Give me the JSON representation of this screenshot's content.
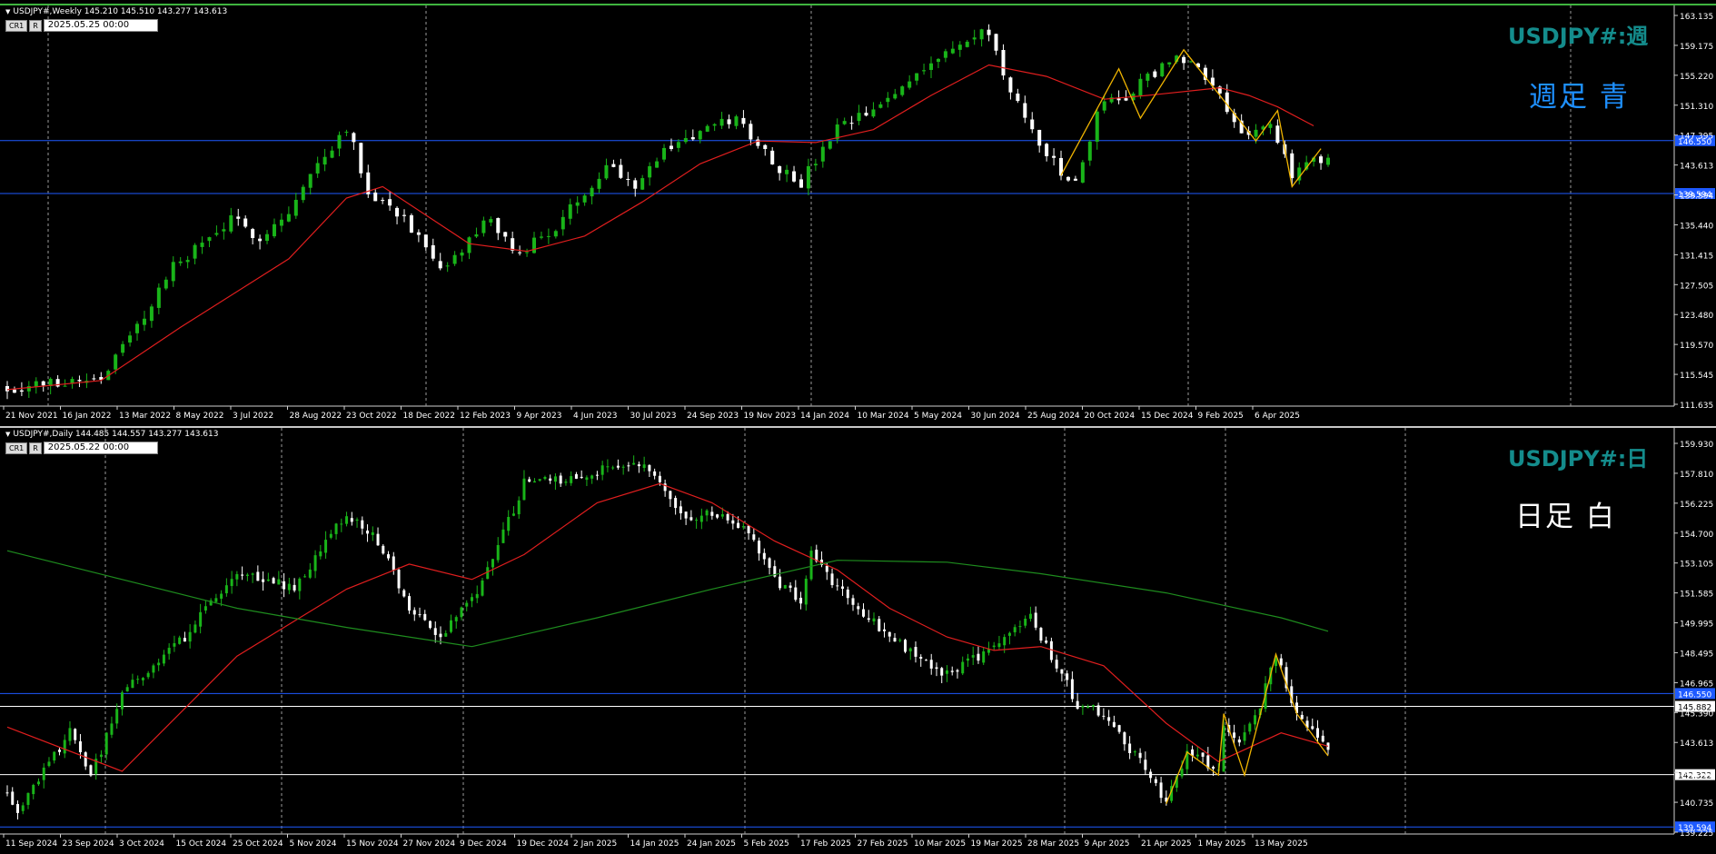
{
  "colors": {
    "background": "#000000",
    "bull_candle": "#19b419",
    "bear_candle": "#ffffff",
    "ma_red": "#e01e1e",
    "ma_green": "#1e8c1e",
    "zigzag": "#f0b400",
    "blue_level": "#1e5aff",
    "symbol_text": "#148c8c"
  },
  "weekly": {
    "header": "USDJPY#,Weekly  145.210 145.510 143.277 143.613",
    "box1": "CR1",
    "box2": "R",
    "date_box": "2025.05.25 00:00",
    "symbol_label": "USDJPY#:週",
    "note": "週足  青",
    "price_ticks": [
      "163.135",
      "159.175",
      "155.220",
      "151.310",
      "147.395",
      "143.613",
      "139.594",
      "135.440",
      "131.415",
      "127.505",
      "123.480",
      "119.570",
      "115.545",
      "111.635"
    ],
    "date_ticks": [
      "21 Nov 2021",
      "16 Jan 2022",
      "13 Mar 2022",
      "8 May 2022",
      "3 Jul 2022",
      "28 Aug 2022",
      "23 Oct 2022",
      "18 Dec 2022",
      "12 Feb 2023",
      "9 Apr 2023",
      "4 Jun 2023",
      "30 Jul 2023",
      "24 Sep 2023",
      "19 Nov 2023",
      "14 Jan 2024",
      "10 Mar 2024",
      "5 May 2024",
      "30 Jun 2024",
      "25 Aug 2024",
      "20 Oct 2024",
      "15 Dec 2024",
      "9 Feb 2025",
      "6 Apr 2025"
    ],
    "level_lines": [
      {
        "price": 146.55,
        "label": "146.550"
      },
      {
        "price": 139.594,
        "label": "139.594"
      }
    ],
    "current_price": "143.613"
  },
  "daily": {
    "header": "USDJPY#,Daily  144.485 144.557 143.277 143.613",
    "box1": "CR1",
    "box2": "R",
    "date_box": "2025.05.22 00:00",
    "symbol_label": "USDJPY#:日",
    "note": "日足   白",
    "price_ticks": [
      "159.930",
      "157.810",
      "156.225",
      "154.700",
      "153.105",
      "151.585",
      "149.995",
      "148.495",
      "146.965",
      "145.390",
      "143.613",
      "142.322",
      "140.735",
      "139.225"
    ],
    "date_ticks": [
      "11 Sep 2024",
      "23 Sep 2024",
      "3 Oct 2024",
      "15 Oct 2024",
      "25 Oct 2024",
      "5 Nov 2024",
      "15 Nov 2024",
      "27 Nov 2024",
      "9 Dec 2024",
      "19 Dec 2024",
      "2 Jan 2025",
      "14 Jan 2025",
      "24 Jan 2025",
      "5 Feb 2025",
      "17 Feb 2025",
      "27 Feb 2025",
      "10 Mar 2025",
      "19 Mar 2025",
      "28 Mar 2025",
      "9 Apr 2025",
      "21 Apr 2025",
      "1 May 2025",
      "13 May 2025"
    ],
    "level_lines": [
      {
        "price": 146.55,
        "label": "146.550",
        "color": "blue"
      },
      {
        "price": 145.882,
        "label": "145.882",
        "color": "white"
      },
      {
        "price": 142.322,
        "label": "142.322",
        "color": "white"
      },
      {
        "price": 139.594,
        "label": "139.594",
        "color": "blue"
      }
    ],
    "current_price": "143.613"
  },
  "chart_data": [
    {
      "type": "candlestick",
      "title": "USDJPY#,Weekly",
      "ylim": [
        111.635,
        163.135
      ],
      "x_range": [
        "21 Nov 2021",
        "25 May 2025"
      ],
      "path_points": [
        [
          "21 Nov 2021",
          114.0
        ],
        [
          "20 Feb 2022",
          115.5
        ],
        [
          "27 Mar 2022",
          122.0
        ],
        [
          "1 May 2022",
          130.0
        ],
        [
          "26 Jun 2022",
          136.0
        ],
        [
          "24 Jul 2022",
          134.0
        ],
        [
          "21 Aug 2022",
          137.0
        ],
        [
          "18 Sep 2022",
          143.5
        ],
        [
          "16 Oct 2022",
          148.5
        ],
        [
          "6 Nov 2022",
          140.0
        ],
        [
          "11 Dec 2022",
          136.5
        ],
        [
          "15 Jan 2023",
          129.0
        ],
        [
          "5 Mar 2023",
          136.5
        ],
        [
          "26 Mar 2023",
          131.5
        ],
        [
          "7 May 2023",
          135.0
        ],
        [
          "25 Jun 2023",
          143.5
        ],
        [
          "23 Jul 2023",
          141.0
        ],
        [
          "27 Aug 2023",
          146.0
        ],
        [
          "29 Oct 2023",
          149.5
        ],
        [
          "10 Dec 2023",
          143.0
        ],
        [
          "31 Dec 2023",
          141.0
        ],
        [
          "4 Feb 2024",
          148.0
        ],
        [
          "17 Mar 2024",
          151.0
        ],
        [
          "28 Apr 2024",
          156.5
        ],
        [
          "30 Jun 2024",
          161.0
        ],
        [
          "21 Jul 2024",
          152.5
        ],
        [
          "8 Sep 2024",
          142.0
        ],
        [
          "22 Sep 2024",
          141.0
        ],
        [
          "20 Oct 2024",
          152.5
        ],
        [
          "3 Nov 2024",
          151.5
        ],
        [
          "15 Dec 2024",
          156.5
        ],
        [
          "5 Jan 2025",
          157.5
        ],
        [
          "2 Feb 2025",
          154.5
        ],
        [
          "23 Feb 2025",
          149.0
        ],
        [
          "9 Mar 2025",
          147.5
        ],
        [
          "30 Mar 2025",
          148.0
        ],
        [
          "20 Apr 2025",
          142.0
        ],
        [
          "11 May 2025",
          145.0
        ],
        [
          "25 May 2025",
          143.6
        ]
      ],
      "series": [
        {
          "name": "",
          "points": [
            [
              "21 Nov 2021",
              113.8
            ],
            [
              "20 Feb 2022",
              115.0
            ],
            [
              "8 May 2022",
              122.0
            ],
            [
              "21 Aug 2022",
              131.0
            ],
            [
              "16 Oct 2022",
              139.0
            ],
            [
              "20 Nov 2022",
              140.5
            ],
            [
              "12 Feb 2023",
              133.0
            ],
            [
              "9 Apr 2023",
              132.0
            ],
            [
              "4 Jun 2023",
              134.0
            ],
            [
              "30 Jul 2023",
              138.5
            ],
            [
              "24 Sep 2023",
              143.5
            ],
            [
              "19 Nov 2023",
              146.5
            ],
            [
              "14 Jan 2024",
              146.3
            ],
            [
              "10 Mar 2024",
              148.0
            ],
            [
              "5 May 2024",
              152.5
            ],
            [
              "30 Jun 2024",
              156.5
            ],
            [
              "25 Aug 2024",
              155.0
            ],
            [
              "20 Oct 2024",
              152.0
            ],
            [
              "1 Dec 2024",
              152.5
            ],
            [
              "9 Feb 2025",
              153.5
            ],
            [
              "9 Mar 2025",
              152.5
            ],
            [
              "6 Apr 2025",
              151.0
            ],
            [
              "11 May 2025",
              148.5
            ]
          ]
        }
      ],
      "zigzag": [
        [
          "8 Sep 2024",
          142.0
        ],
        [
          "3 Nov 2024",
          156.0
        ],
        [
          "24 Nov 2024",
          149.5
        ],
        [
          "5 Jan 2025",
          158.5
        ],
        [
          "16 Mar 2025",
          146.5
        ],
        [
          "6 Apr 2025",
          150.5
        ],
        [
          "20 Apr 2025",
          140.5
        ],
        [
          "18 May 2025",
          145.5
        ]
      ]
    },
    {
      "type": "candlestick",
      "title": "USDJPY#,Daily",
      "ylim": [
        139.225,
        159.93
      ],
      "x_range": [
        "11 Sep 2024",
        "22 May 2025"
      ],
      "path_points": [
        [
          "11 Sep 2024",
          141.5
        ],
        [
          "13 Sep 2024",
          140.5
        ],
        [
          "23 Sep 2024",
          144.5
        ],
        [
          "27 Sep 2024",
          142.2
        ],
        [
          "3 Oct 2024",
          146.5
        ],
        [
          "15 Oct 2024",
          149.5
        ],
        [
          "25 Oct 2024",
          153.0
        ],
        [
          "5 Nov 2024",
          152.0
        ],
        [
          "15 Nov 2024",
          156.0
        ],
        [
          "21 Nov 2024",
          154.5
        ],
        [
          "27 Nov 2024",
          151.0
        ],
        [
          "3 Dec 2024",
          149.5
        ],
        [
          "9 Dec 2024",
          151.5
        ],
        [
          "13 Dec 2024",
          153.5
        ],
        [
          "19 Dec 2024",
          157.5
        ],
        [
          "27 Dec 2024",
          157.8
        ],
        [
          "10 Jan 2025",
          158.6
        ],
        [
          "14 Jan 2025",
          157.5
        ],
        [
          "20 Jan 2025",
          155.5
        ],
        [
          "24 Jan 2025",
          156.0
        ],
        [
          "31 Jan 2025",
          155.0
        ],
        [
          "5 Feb 2025",
          152.5
        ],
        [
          "10 Feb 2025",
          151.5
        ],
        [
          "12 Feb 2025",
          154.0
        ],
        [
          "17 Feb 2025",
          152.0
        ],
        [
          "27 Feb 2025",
          149.5
        ],
        [
          "10 Mar 2025",
          147.5
        ],
        [
          "19 Mar 2025",
          149.0
        ],
        [
          "26 Mar 2025",
          150.5
        ],
        [
          "28 Mar 2025",
          149.5
        ],
        [
          "4 Apr 2025",
          146.0
        ],
        [
          "9 Apr 2025",
          145.5
        ],
        [
          "16 Apr 2025",
          143.0
        ],
        [
          "21 Apr 2025",
          140.8
        ],
        [
          "25 Apr 2025",
          143.5
        ],
        [
          "1 May 2025",
          142.5
        ],
        [
          "2 May 2025",
          145.0
        ],
        [
          "5 May 2025",
          144.0
        ],
        [
          "9 May 2025",
          146.0
        ],
        [
          "12 May 2025",
          148.5
        ],
        [
          "16 May 2025",
          145.5
        ],
        [
          "22 May 2025",
          143.6
        ]
      ],
      "series": [
        {
          "name": "",
          "points": [
            [
              "11 Sep 2024",
              144.8
            ],
            [
              "3 Oct 2024",
              142.5
            ],
            [
              "25 Oct 2024",
              148.5
            ],
            [
              "15 Nov 2024",
              152.0
            ],
            [
              "27 Nov 2024",
              153.3
            ],
            [
              "9 Dec 2024",
              152.5
            ],
            [
              "19 Dec 2024",
              153.8
            ],
            [
              "2 Jan 2025",
              156.5
            ],
            [
              "14 Jan 2025",
              157.5
            ],
            [
              "24 Jan 2025",
              156.5
            ],
            [
              "5 Feb 2025",
              154.5
            ],
            [
              "17 Feb 2025",
              153.0
            ],
            [
              "27 Feb 2025",
              151.0
            ],
            [
              "10 Mar 2025",
              149.5
            ],
            [
              "19 Mar 2025",
              148.8
            ],
            [
              "28 Mar 2025",
              149.0
            ],
            [
              "9 Apr 2025",
              148.0
            ],
            [
              "21 Apr 2025",
              145.0
            ],
            [
              "1 May 2025",
              143.0
            ],
            [
              "13 May 2025",
              144.5
            ],
            [
              "22 May 2025",
              143.8
            ]
          ]
        },
        {
          "name": "",
          "points": [
            [
              "11 Sep 2024",
              154.0
            ],
            [
              "3 Oct 2024",
              152.5
            ],
            [
              "25 Oct 2024",
              151.0
            ],
            [
              "15 Nov 2024",
              150.0
            ],
            [
              "9 Dec 2024",
              149.0
            ],
            [
              "2 Jan 2025",
              150.5
            ],
            [
              "24 Jan 2025",
              152.0
            ],
            [
              "17 Feb 2025",
              153.5
            ],
            [
              "10 Mar 2025",
              153.4
            ],
            [
              "28 Mar 2025",
              152.8
            ],
            [
              "21 Apr 2025",
              151.8
            ],
            [
              "13 May 2025",
              150.5
            ],
            [
              "22 May 2025",
              149.8
            ]
          ]
        }
      ],
      "zigzag": [
        [
          "21 Apr 2025",
          140.8
        ],
        [
          "25 Apr 2025",
          143.5
        ],
        [
          "1 May 2025",
          142.3
        ],
        [
          "2 May 2025",
          145.5
        ],
        [
          "6 May 2025",
          142.3
        ],
        [
          "12 May 2025",
          148.6
        ],
        [
          "16 May 2025",
          145.5
        ],
        [
          "22 May 2025",
          143.3
        ]
      ]
    }
  ]
}
